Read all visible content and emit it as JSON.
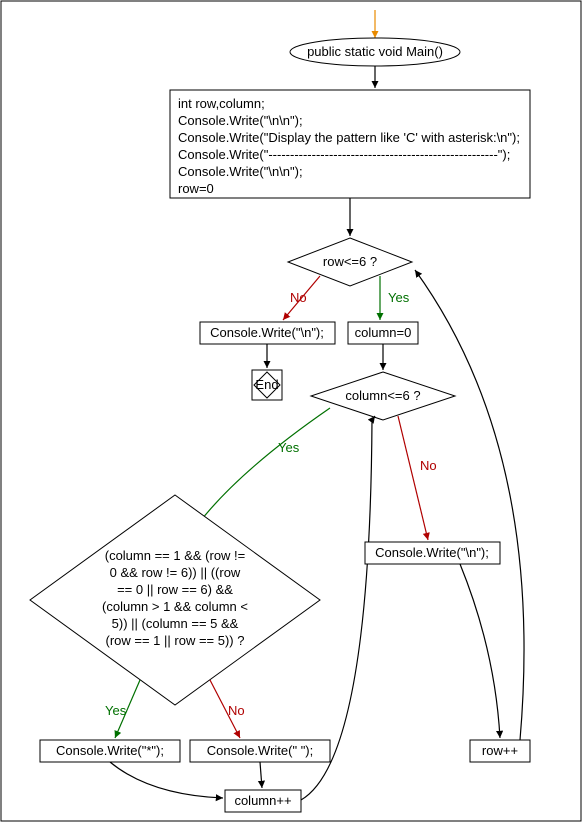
{
  "start": {
    "label": "public static void Main()"
  },
  "init_block": {
    "lines": [
      "int row,column;",
      "Console.Write(\"\\n\\n\");",
      "Console.Write(\"Display the pattern like 'C' with asterisk:\\n\");",
      "Console.Write(\"-----------------------------------------------------\");",
      "Console.Write(\"\\n\\n\");",
      "row=0"
    ]
  },
  "decision_row": {
    "label": "row<=6 ?",
    "yes": "Yes",
    "no": "No"
  },
  "after_row_no": {
    "label": "Console.Write(\"\\n\");"
  },
  "end": {
    "label": "End"
  },
  "set_column": {
    "label": "column=0"
  },
  "decision_column": {
    "label": "column<=6 ?",
    "yes": "Yes",
    "no": "No"
  },
  "decision_big": {
    "lines": [
      "(column == 1 && (row !=",
      "0 && row != 6)) || ((row",
      "== 0 || row == 6) &&",
      "(column > 1 && column <",
      "5)) || (column == 5 &&",
      "(row == 1 || row == 5)) ?"
    ],
    "yes": "Yes",
    "no": "No"
  },
  "write_star": {
    "label": "Console.Write(\"*\");"
  },
  "write_space": {
    "label": "Console.Write(\" \");"
  },
  "write_newline": {
    "label": "Console.Write(\"\\n\");"
  },
  "col_inc": {
    "label": "column++"
  },
  "row_inc": {
    "label": "row++"
  }
}
